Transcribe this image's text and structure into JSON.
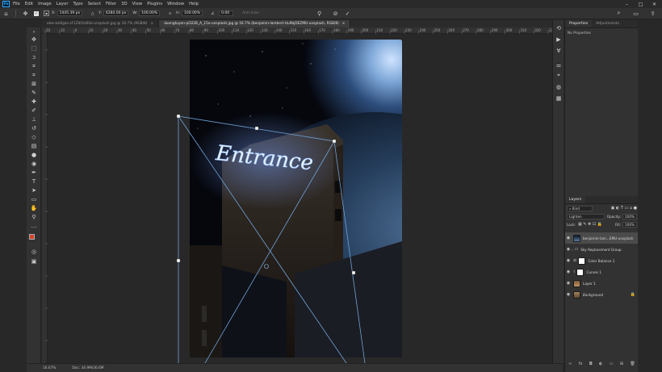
{
  "app": {
    "logo": "Ps",
    "menu": [
      "File",
      "Edit",
      "Image",
      "Layer",
      "Type",
      "Select",
      "Filter",
      "3D",
      "View",
      "Plugins",
      "Window",
      "Help"
    ],
    "window_controls": [
      "minimize",
      "maximize",
      "close"
    ]
  },
  "options": {
    "x_label": "X:",
    "x_value": "1445.39 px",
    "y_label": "Y:",
    "y_value": "4284.00 px",
    "w_label": "W:",
    "w_value": "100.00%",
    "h_label": "H:",
    "h_value": "100.00%",
    "angle_value": "0.00",
    "antialias": "Anti-alias"
  },
  "tabs": [
    {
      "label": "alex-kalligas-sF1ZdOrz6Vo-unsplash.jpg @ 16.7% (RGB/8)",
      "active": false
    },
    {
      "label": "duongtuyen-pO22B_A_15o-unsplash.jpg @ 16.7% (benjamin-lambert-Uu9bjDEZMU-unsplash, RGB/8)",
      "active": true
    }
  ],
  "ruler_top_ticks": [
    "20",
    "10",
    "0",
    "10",
    "20",
    "30",
    "40",
    "50",
    "60",
    "70",
    "80",
    "90",
    "100",
    "110",
    "120",
    "130",
    "140",
    "150",
    "160",
    "170",
    "180",
    "190",
    "200",
    "210",
    "220",
    "230",
    "240",
    "250",
    "260",
    "270",
    "280",
    "290",
    "300",
    "310",
    "320",
    "330",
    "340"
  ],
  "canvas": {
    "sign_text": "Entrance"
  },
  "status": {
    "zoom": "16.67%",
    "doc_size": "Doc: 34.9M/36.6M"
  },
  "properties": {
    "tab_properties": "Properties",
    "tab_adjustments": "Adjustments",
    "empty_text": "No Properties"
  },
  "layers": {
    "tab_label": "Layers",
    "kind_label": "Kind",
    "blend_mode": "Lighten",
    "opacity_label": "Opacity:",
    "opacity_value": "100%",
    "lock_label": "Lock:",
    "fill_label": "Fill:",
    "fill_value": "100%",
    "items": [
      {
        "name": "benjamin-lam...EMU-unsplash",
        "type": "image",
        "selected": true
      },
      {
        "name": "Sky Replacement Group",
        "type": "group",
        "selected": false
      },
      {
        "name": "Color Balance 1",
        "type": "adjustment",
        "selected": false
      },
      {
        "name": "Curves 1",
        "type": "adjustment",
        "selected": false
      },
      {
        "name": "Layer 1",
        "type": "pixel",
        "selected": false
      },
      {
        "name": "Background",
        "type": "background",
        "selected": false
      }
    ]
  },
  "colors": {
    "foreground": "#d6422a",
    "background": "#ffffff",
    "neon": "#9fc6ff",
    "accent": "#31a8ff"
  }
}
